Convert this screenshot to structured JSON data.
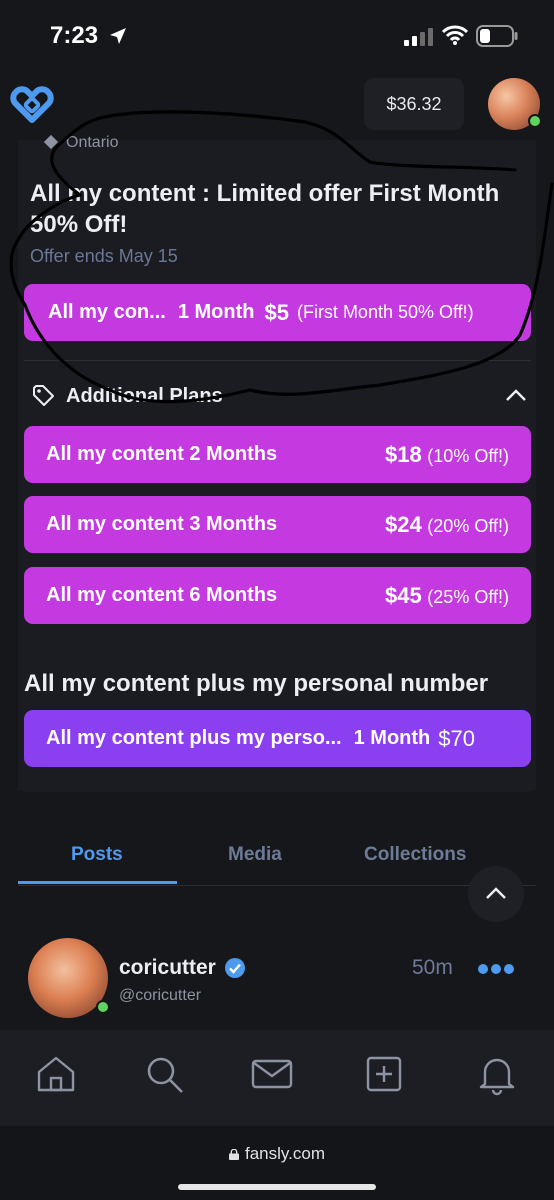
{
  "status_bar": {
    "time": "7:23"
  },
  "header": {
    "balance": "$36.32"
  },
  "creator": {
    "location": "Ontario"
  },
  "offer": {
    "title": "All my content : Limited offer First Month 50% Off!",
    "ends": "Offer ends May 15",
    "button": {
      "name": "All my con...",
      "duration": "1 Month",
      "price": "$5",
      "discount": "(First Month 50% Off!)"
    }
  },
  "additional_plans": {
    "heading": "Additional Plans",
    "plans": [
      {
        "name": "All my content",
        "duration": "2 Months",
        "price": "$18",
        "discount": "(10% Off!)"
      },
      {
        "name": "All my content",
        "duration": "3 Months",
        "price": "$24",
        "discount": "(20% Off!)"
      },
      {
        "name": "All my content",
        "duration": "6 Months",
        "price": "$45",
        "discount": "(25% Off!)"
      }
    ]
  },
  "personal_tier": {
    "title": "All my content plus my personal number",
    "button": {
      "name": "All my content plus my perso...",
      "duration": "1 Month",
      "price": "$70"
    }
  },
  "tabs": [
    {
      "label": "Posts",
      "active": true
    },
    {
      "label": "Media",
      "active": false
    },
    {
      "label": "Collections",
      "active": false
    }
  ],
  "post": {
    "display_name": "coricutter",
    "handle": "@coricutter",
    "time": "50m"
  },
  "bottom_nav": [
    "home-icon",
    "search-icon",
    "messages-icon",
    "create-icon",
    "notifications-icon"
  ],
  "browser": {
    "url": "fansly.com"
  },
  "colors": {
    "accent_blue": "#4d9aee",
    "plan_purple": "#c53ae0",
    "tier_violet": "#8a3ff0",
    "online_green": "#5fd35f"
  }
}
